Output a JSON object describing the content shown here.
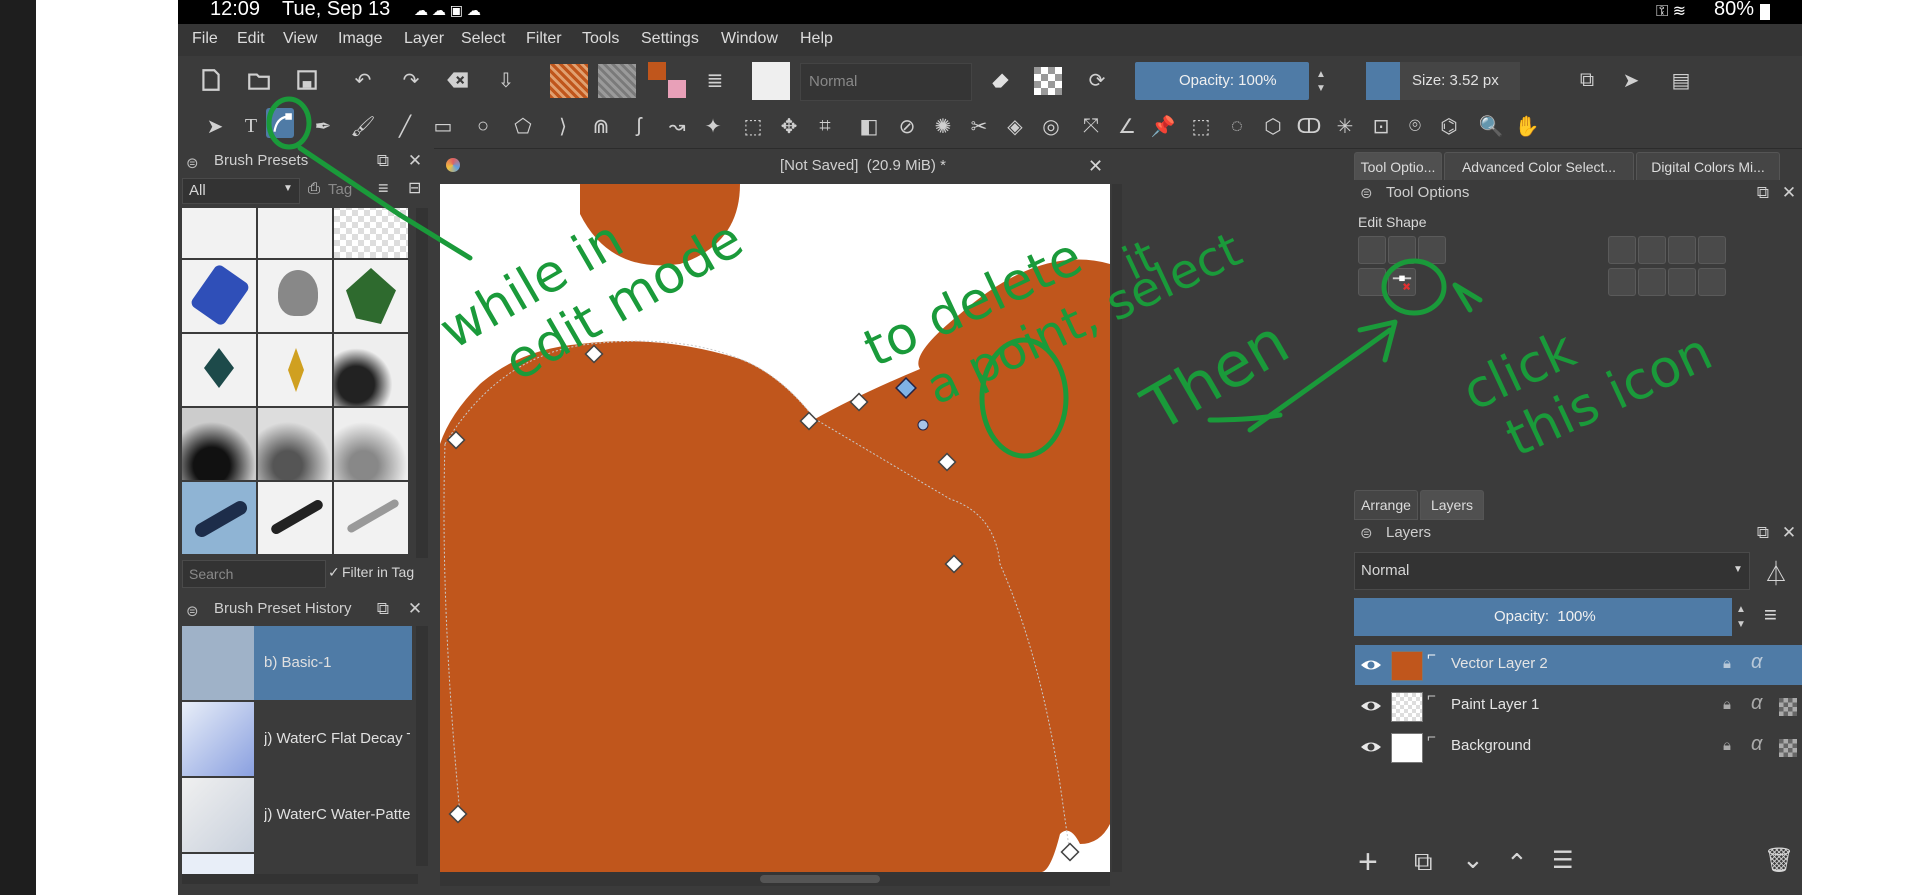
{
  "status": {
    "time": "12:09",
    "date": "Tue, Sep 13",
    "battery": "80%"
  },
  "menu": [
    "File",
    "Edit",
    "View",
    "Image",
    "Layer",
    "Select",
    "Filter",
    "Tools",
    "Settings",
    "Window",
    "Help"
  ],
  "toolbar": {
    "blend_mode": "Normal",
    "opacity": "Opacity: 100%",
    "size": "Size: 3.52 px"
  },
  "brush_presets": {
    "title": "Brush Presets",
    "filter_value": "All",
    "tag_label": "Tag",
    "search_placeholder": "Search",
    "filter_in_tag": "Filter in Tag"
  },
  "brush_history": {
    "title": "Brush Preset History",
    "items": [
      "b) Basic-1",
      "j) WaterC Flat Decay Ti",
      "j) WaterC Water-Pattern"
    ]
  },
  "document": {
    "title": "[Not Saved]  (20.9 MiB) *"
  },
  "right_tabs": [
    "Tool Optio...",
    "Advanced Color Select...",
    "Digital Colors Mi..."
  ],
  "tool_options": {
    "title": "Tool Options",
    "section": "Edit Shape"
  },
  "layers_tabs": [
    "Arrange",
    "Layers"
  ],
  "layers": {
    "title": "Layers",
    "blend_mode": "Normal",
    "opacity": "Opacity:  100%",
    "items": [
      {
        "name": "Vector Layer 2",
        "selected": true
      },
      {
        "name": "Paint Layer 1",
        "selected": false
      },
      {
        "name": "Background",
        "selected": false
      }
    ]
  },
  "annotations": {
    "left": [
      "while in",
      "edit mode"
    ],
    "middle": [
      "to delete",
      "a point, select",
      "it"
    ],
    "then": "Then",
    "right": [
      "click",
      "this icon"
    ]
  },
  "colors": {
    "brush_orange": "#c0561c",
    "accent_blue": "#4f7ba6",
    "annotation_green": "#1a9a3a"
  }
}
